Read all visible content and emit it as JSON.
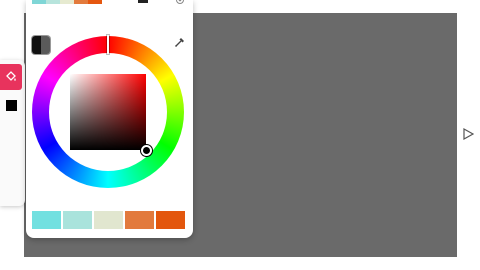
{
  "canvas": {
    "background": "#6a6a6a"
  },
  "left_toolbar": {
    "fill_tool_color": "#e8335d",
    "current_color": "#000000"
  },
  "color_picker": {
    "current_swatch": {
      "primary": "#111111",
      "secondary": "#5a5a5a"
    },
    "hue_wheel": {
      "hue_degrees": 0
    },
    "selected_color": "#000000",
    "top_swatches": [
      "#7fd6d6",
      "#b7e4dc",
      "#e6ead0",
      "#e37a3c",
      "#e5570f"
    ],
    "palette": [
      "#72e0e0",
      "#a9e3dc",
      "#e1e6cf",
      "#e27a3d",
      "#e3570e"
    ]
  },
  "icons": {
    "fill_tool": "paint-bucket-icon",
    "eyedropper": "eyedropper-icon",
    "settings": "gear-icon",
    "next": "play-arrow-icon"
  }
}
